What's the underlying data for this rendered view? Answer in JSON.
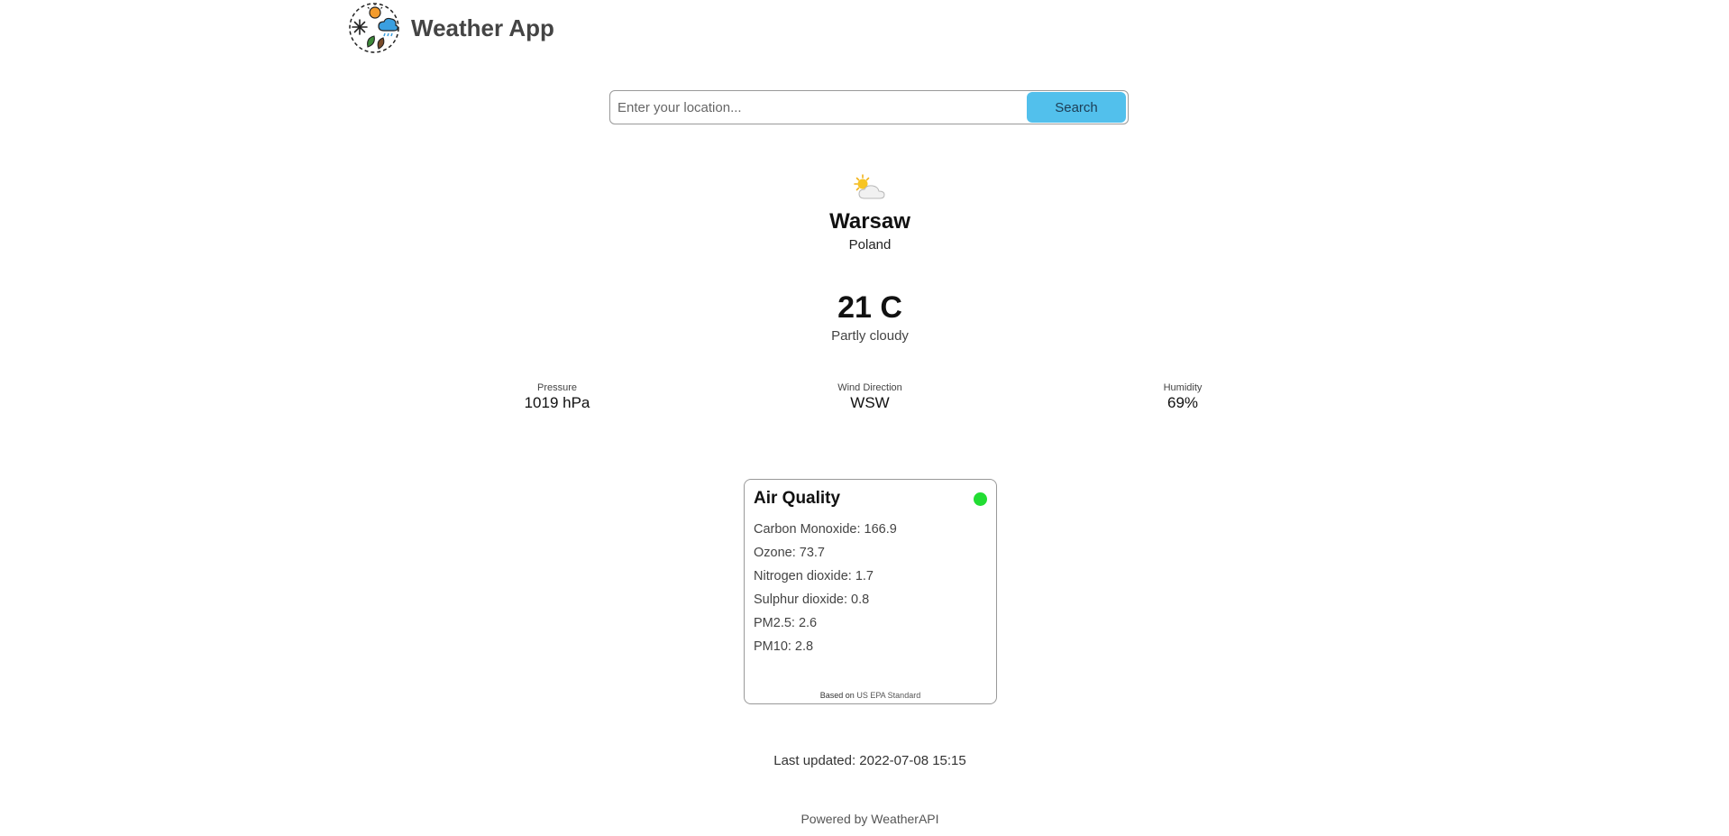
{
  "header": {
    "app_title": "Weather App",
    "logo_icon": "weather-app-logo-icon"
  },
  "search": {
    "placeholder": "Enter your location...",
    "value": "",
    "button_label": "Search"
  },
  "current": {
    "condition_icon": "partly-cloudy-icon",
    "city": "Warsaw",
    "country": "Poland",
    "temperature": "21 C",
    "condition": "Partly cloudy"
  },
  "stats": {
    "pressure": {
      "label": "Pressure",
      "value": "1019 hPa"
    },
    "wind_direction": {
      "label": "Wind Direction",
      "value": "WSW"
    },
    "humidity": {
      "label": "Humidity",
      "value": "69%"
    }
  },
  "air_quality": {
    "title": "Air Quality",
    "status_color": "#22dd33",
    "items": [
      "Carbon Monoxide: 166.9",
      "Ozone: 73.7",
      "Nitrogen dioxide: 1.7",
      "Sulphur dioxide: 0.8",
      "PM2.5: 2.6",
      "PM10: 2.8"
    ],
    "footer_prefix": "Based on",
    "footer_standard": "US EPA Standard"
  },
  "last_updated": "Last updated: 2022-07-08 15:15",
  "powered_by": "Powered by WeatherAPI",
  "colors": {
    "search_button": "#52c0ec",
    "good_air_quality": "#22dd33"
  }
}
